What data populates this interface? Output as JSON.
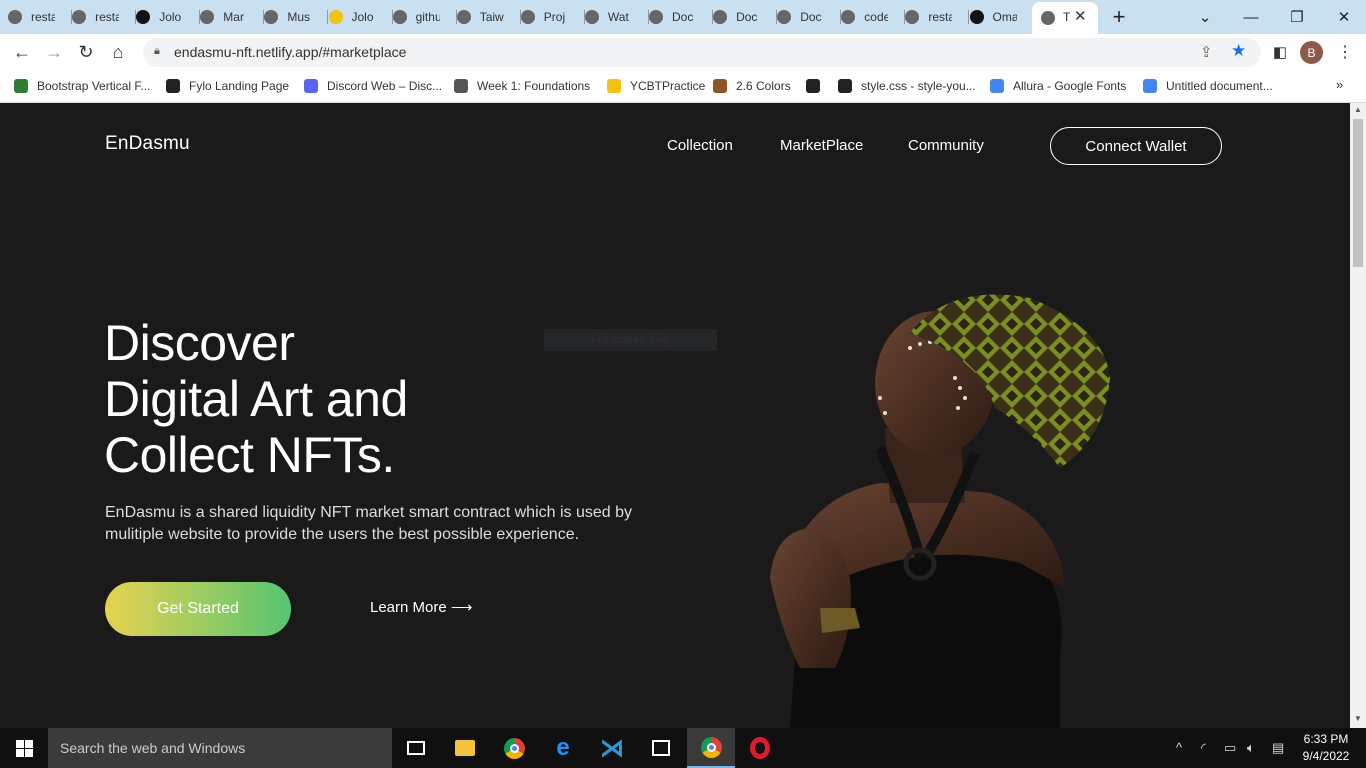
{
  "browser": {
    "tabs": [
      {
        "label": "resta",
        "icon": "globe-icon"
      },
      {
        "label": "resta",
        "icon": "globe-icon"
      },
      {
        "label": "Jolo",
        "icon": "github-icon"
      },
      {
        "label": "Mar",
        "icon": "globe-icon"
      },
      {
        "label": "Mus",
        "icon": "globe-icon"
      },
      {
        "label": "Jolo",
        "icon": "netlify-icon"
      },
      {
        "label": "githu",
        "icon": "globe-icon"
      },
      {
        "label": "Taiw",
        "icon": "globe-icon"
      },
      {
        "label": "Proj",
        "icon": "globe-icon"
      },
      {
        "label": "Wat",
        "icon": "globe-icon"
      },
      {
        "label": "Doc",
        "icon": "globe-icon"
      },
      {
        "label": "Doc",
        "icon": "globe-icon"
      },
      {
        "label": "Doc",
        "icon": "globe-icon"
      },
      {
        "label": "code",
        "icon": "globe-icon"
      },
      {
        "label": "resta",
        "icon": "globe-icon"
      },
      {
        "label": "Oma",
        "icon": "github-icon"
      }
    ],
    "active_tab": {
      "label": "T"
    },
    "url": "endasmu-nft.netlify.app/#marketplace",
    "profile_initial": "B",
    "bookmarks": [
      {
        "label": "Bootstrap Vertical F...",
        "color": "#2e7d32"
      },
      {
        "label": "Fylo Landing Page",
        "color": "#222222"
      },
      {
        "label": "Discord Web – Disc...",
        "color": "#5865f2"
      },
      {
        "label": "Week 1: Foundations",
        "color": "#555555"
      },
      {
        "label": "YCBTPractice",
        "color": "#f4c20d"
      },
      {
        "label": "2.6 Colors",
        "color": "#8d5524"
      },
      {
        "label": "",
        "color": "#222222"
      },
      {
        "label": "style.css - style-you...",
        "color": "#222222"
      },
      {
        "label": "Allura - Google Fonts",
        "color": "#4285f4"
      },
      {
        "label": "Untitled document...",
        "color": "#4285f4"
      }
    ]
  },
  "site": {
    "logo": "EnDasmu",
    "nav": [
      "Collection",
      "MarketPlace",
      "Community"
    ],
    "wallet_button": "Connect Wallet",
    "headline": [
      "Discover",
      "Digital Art and",
      "Collect NFTs."
    ],
    "description": "EnDasmu is a shared liquidity NFT market smart contract which is used by mulitiple website to provide the users the best possible experience.",
    "cta_primary": "Get Started",
    "cta_secondary": "Learn More ⟶",
    "snip_label": "Full-screen Snip"
  },
  "taskbar": {
    "search_placeholder": "Search the web and Windows",
    "time": "6:33 PM",
    "date": "9/4/2022"
  },
  "colors": {
    "page_bg": "#1b1a1b",
    "gradient_start": "#e6d34e",
    "gradient_end": "#57c572",
    "tabbar_bg": "#c9e0f1"
  }
}
